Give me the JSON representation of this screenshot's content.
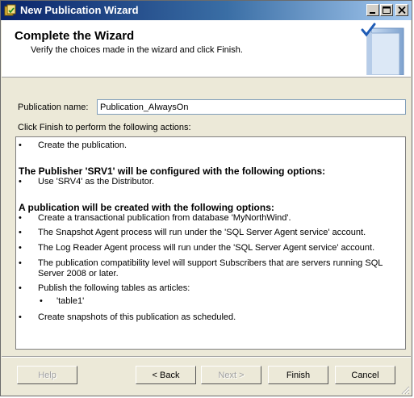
{
  "window": {
    "title": "New Publication Wizard"
  },
  "header": {
    "title": "Complete the Wizard",
    "subtitle": "Verify the choices made in the wizard and click Finish."
  },
  "form": {
    "name_label": "Publication name:",
    "name_value": "Publication_AlwaysOn",
    "actions_label": "Click Finish to perform the following actions:"
  },
  "actions": {
    "create_item": "Create the publication.",
    "publisher_heading": "The Publisher 'SRV1' will be configured with the following options:",
    "publisher_item": "Use 'SRV4' as the Distributor.",
    "publication_heading": "A publication will be created with the following options:",
    "items": [
      "Create a transactional publication from database 'MyNorthWind'.",
      "The Snapshot Agent process will run under the 'SQL Server Agent service' account.",
      "The Log Reader Agent process will run under the 'SQL Server Agent service' account.",
      "The publication compatibility level will support Subscribers that are servers running SQL",
      "Server 2008 or later.",
      "Publish the following tables as articles:",
      "'table1'",
      "Create snapshots of this publication as scheduled."
    ],
    "bullet": "•"
  },
  "buttons": {
    "help": "Help",
    "back": "< Back",
    "next": "Next >",
    "finish": "Finish",
    "cancel": "Cancel"
  },
  "colors": {
    "titlebar_start": "#0a246a",
    "titlebar_end": "#a6caf0",
    "dialog_bg": "#ece9d8",
    "header_bg": "#ffffff"
  },
  "icons": [
    "app-icon",
    "minimize-icon",
    "maximize-icon",
    "close-icon",
    "wizard-book-check-icon",
    "resize-grip-icon"
  ]
}
